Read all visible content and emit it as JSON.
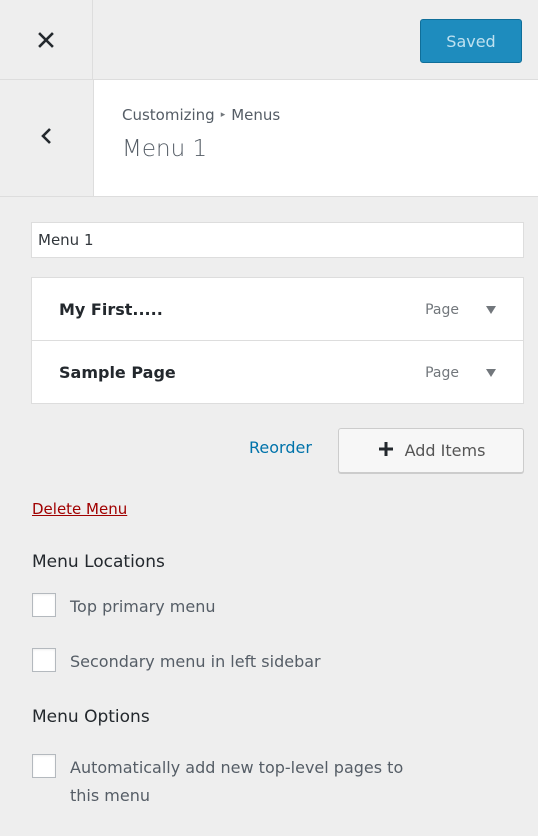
{
  "topbar": {
    "close_icon": "close-icon",
    "saved_label": "Saved",
    "accent_color": "#1e8cbe"
  },
  "header": {
    "back_icon": "chevron-left-icon",
    "breadcrumb_parent": "Customizing",
    "breadcrumb_separator": "▸",
    "breadcrumb_current": "Menus",
    "title": "Menu 1"
  },
  "menu_name": {
    "value": "Menu 1"
  },
  "menu_items": [
    {
      "title": "My First.....",
      "type": "Page"
    },
    {
      "title": "Sample Page",
      "type": "Page"
    }
  ],
  "actions": {
    "reorder_label": "Reorder",
    "add_items_label": "Add Items"
  },
  "delete_label": "Delete Menu",
  "locations": {
    "heading": "Menu Locations",
    "items": [
      {
        "label": "Top primary menu",
        "checked": false
      },
      {
        "label": "Secondary menu in left sidebar",
        "checked": false
      }
    ]
  },
  "options": {
    "heading": "Menu Options",
    "auto_add_line1": "Automatically add new top-level pages to",
    "auto_add_line2": "this menu",
    "auto_add_checked": false
  }
}
